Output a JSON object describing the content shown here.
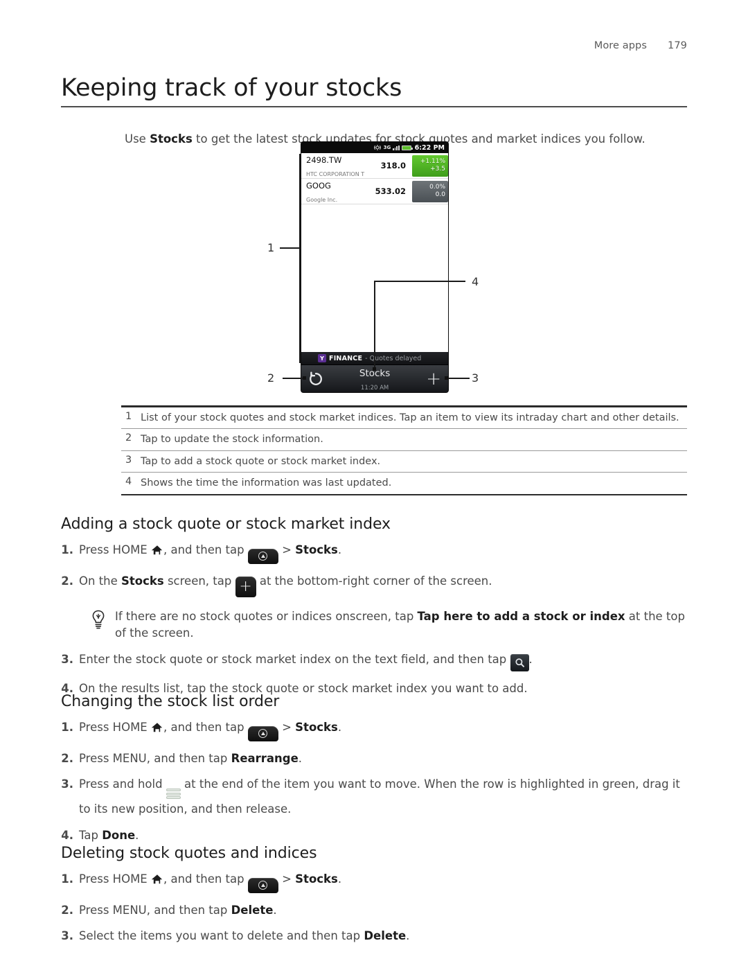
{
  "header": {
    "section": "More apps",
    "page_number": "179"
  },
  "title": "Keeping track of your stocks",
  "intro": {
    "before": "Use ",
    "bold": "Stocks",
    "after": " to get the latest stock updates for stock quotes and market indices you follow."
  },
  "phone": {
    "statusbar": {
      "network": "3G",
      "time": "6:22 PM"
    },
    "stocks": [
      {
        "symbol": "2498.TW",
        "company": "HTC CORPORATION T",
        "price": "318.0",
        "percent": "+1.11%",
        "change": "+3.5",
        "direction": "up"
      },
      {
        "symbol": "GOOG",
        "company": "Google Inc.",
        "price": "533.02",
        "percent": "0.0%",
        "change": "0.0",
        "direction": "flat"
      }
    ],
    "finance_bar": {
      "brand_initial": "Y",
      "brand": "FINANCE",
      "note": "- Quotes delayed"
    },
    "bottom_bar": {
      "title": "Stocks",
      "time": "11:20 AM",
      "refresh": "refresh-icon",
      "add": "+"
    }
  },
  "callouts": {
    "one": "1",
    "two": "2",
    "three": "3",
    "four": "4"
  },
  "legend": [
    {
      "num": "1",
      "text": "List of your stock quotes and stock market indices. Tap an item to view its intraday chart and other details."
    },
    {
      "num": "2",
      "text": "Tap to update the stock information."
    },
    {
      "num": "3",
      "text": "Tap to add a stock quote or stock market index."
    },
    {
      "num": "4",
      "text": "Shows the time the information was last updated."
    }
  ],
  "sections": {
    "adding": {
      "heading": "Adding a stock quote or stock market index",
      "step1": {
        "n": "1.",
        "a": "Press HOME ",
        "b": ", and then tap ",
        "c": " > ",
        "bold": "Stocks",
        "d": "."
      },
      "step2": {
        "n": "2.",
        "a": "On the ",
        "bold": "Stocks",
        "b": " screen, tap ",
        "c": " at the bottom-right corner of the screen."
      },
      "tip": {
        "a": "If there are no stock quotes or indices onscreen, tap ",
        "bold": "Tap here to add a stock or index",
        "b": " at the top of the screen."
      },
      "step3": {
        "n": "3.",
        "a": "Enter the stock quote or stock market index on the text field, and then tap ",
        "b": "."
      },
      "step4": {
        "n": "4.",
        "a": "On the results list, tap the stock quote or stock market index you want to add."
      }
    },
    "changing": {
      "heading": "Changing the stock list order",
      "step1": {
        "n": "1.",
        "a": "Press HOME ",
        "b": ", and then tap ",
        "c": " > ",
        "bold": "Stocks",
        "d": "."
      },
      "step2": {
        "n": "2.",
        "a": "Press MENU, and then tap ",
        "bold": "Rearrange",
        "b": "."
      },
      "step3": {
        "n": "3.",
        "a": "Press and hold ",
        "b": " at the end of the item you want to move. When the row is highlighted in green, drag it to its new position, and then release."
      },
      "step4": {
        "n": "4.",
        "a": "Tap ",
        "bold": "Done",
        "b": "."
      }
    },
    "deleting": {
      "heading": "Deleting stock quotes and indices",
      "step1": {
        "n": "1.",
        "a": "Press HOME ",
        "b": ", and then tap ",
        "c": " > ",
        "bold": "Stocks",
        "d": "."
      },
      "step2": {
        "n": "2.",
        "a": "Press MENU, and then tap ",
        "bold": "Delete",
        "b": "."
      },
      "step3": {
        "n": "3.",
        "a": "Select the items you want to delete and then tap ",
        "bold": "Delete",
        "b": "."
      }
    }
  },
  "colors": {
    "up_badge": "#4fb022",
    "flat_badge": "#5a6066",
    "battery": "#5fbf2e",
    "rule": "#4d4d4d"
  }
}
